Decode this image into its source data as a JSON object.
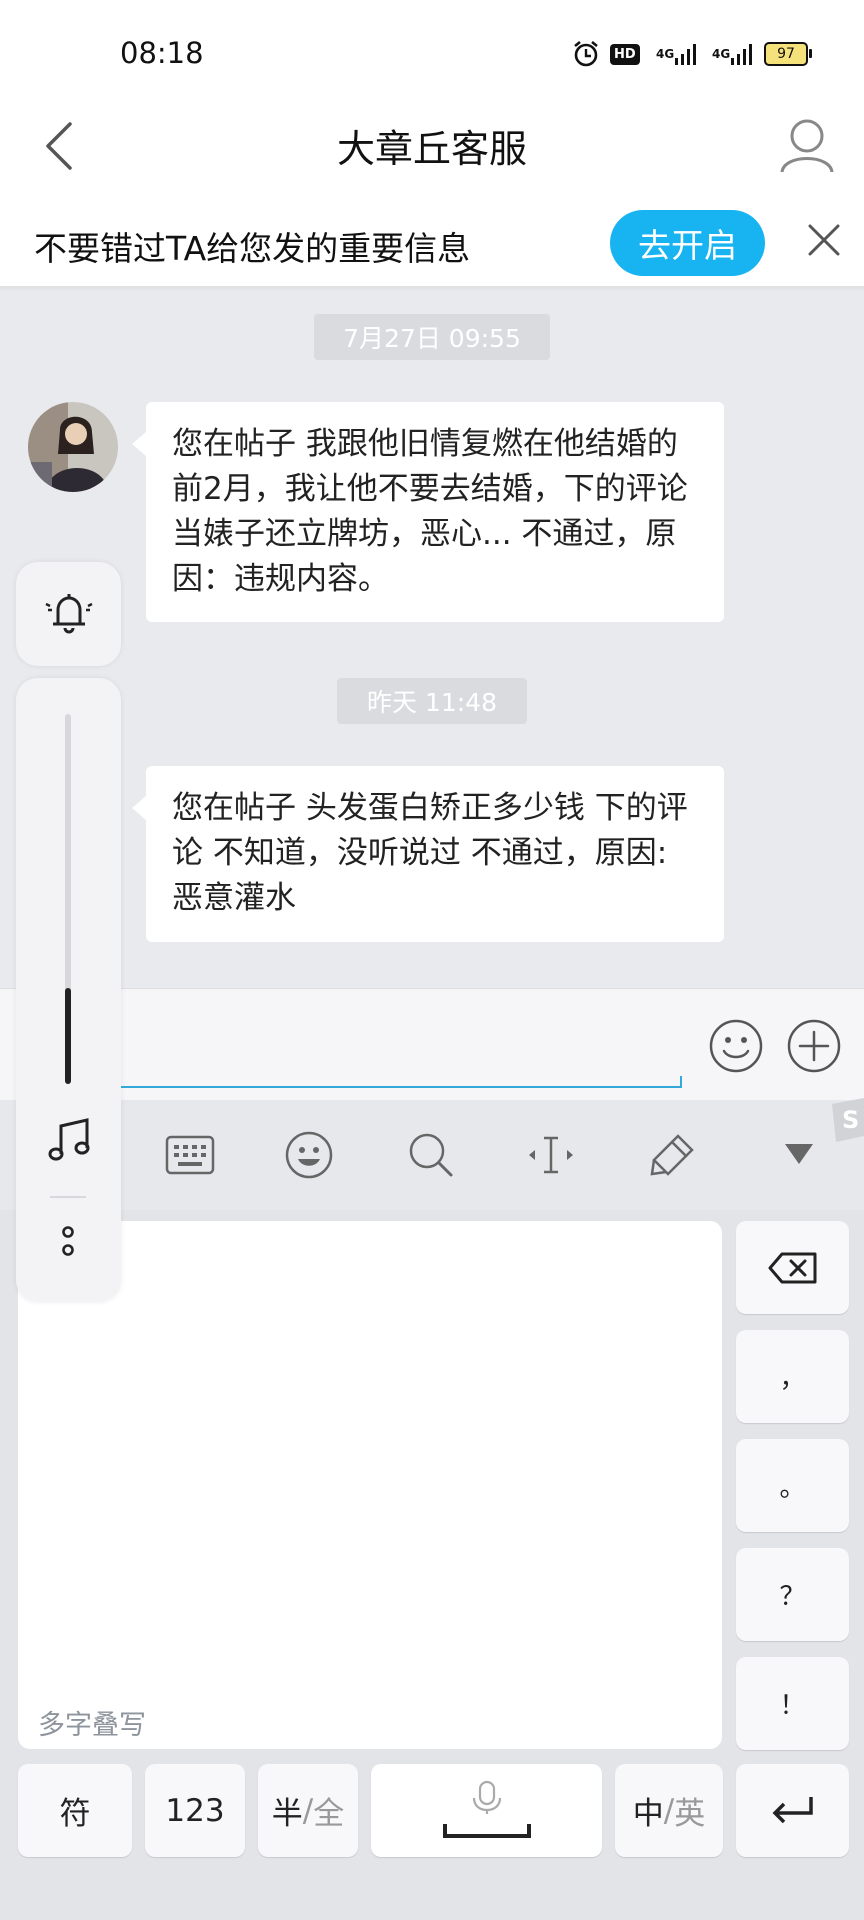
{
  "status_bar": {
    "time": "08:18",
    "net1": "4G",
    "net2": "4G",
    "hd": "HD",
    "battery": "97"
  },
  "header": {
    "title": "大章丘客服"
  },
  "notice": {
    "text": "不要错过TA给您发的重要信息",
    "button": "去开启"
  },
  "messages": [
    {
      "timestamp": "7月27日 09:55",
      "text": "您在帖子 我跟他旧情复燃在他结婚的前2月，我让他不要去结婚，下的评论 当婊子还立牌坊，恶心... 不通过，原因：违规内容。"
    },
    {
      "timestamp": "昨天 11:48",
      "text": "您在帖子 头发蛋白矫正多少钱 下的评论 不知道，没听说过 不通过，原因:恶意灌水"
    }
  ],
  "keyboard": {
    "handwriting_label": "多字叠写",
    "side_keys": [
      "，",
      "。",
      "？",
      "！"
    ],
    "bottom": {
      "symbols": "符",
      "numbers": "123",
      "half": "半",
      "slash1": "/",
      "full": "全",
      "chinese": "中",
      "slash2": "/",
      "english": "英"
    }
  },
  "colors": {
    "accent": "#18b4f2",
    "chat_bg": "#e9eaee",
    "keyboard_bg": "#e3e4e8"
  }
}
